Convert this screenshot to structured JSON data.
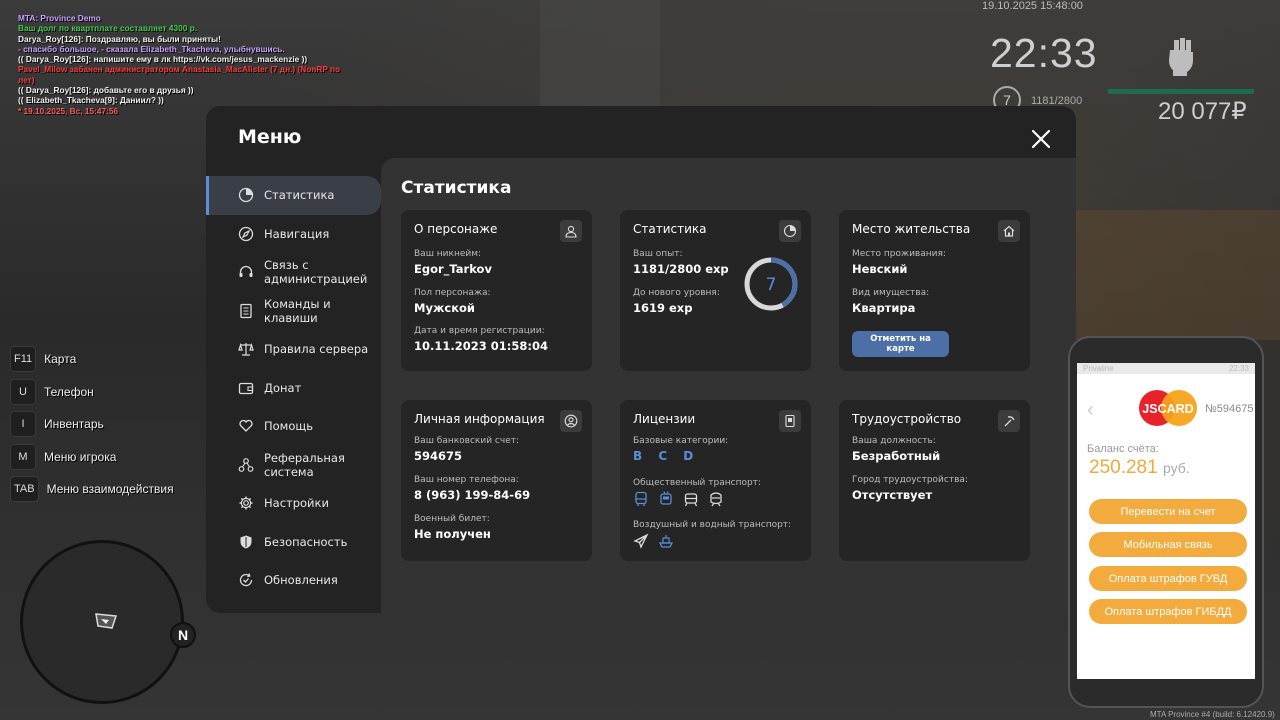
{
  "chat": [
    {
      "text": "MTA: Province Demo",
      "color": "#c9a0ff"
    },
    {
      "text": "Ваш долг по квартплате составляет 4300 р.",
      "color": "#41d24c"
    },
    {
      "text": "Darya_Roy[126]: Поздравляю, вы были приняты!",
      "color": "#f0f0f0"
    },
    {
      "text": "- спасибо большое, - сказала Elizabeth_Tkacheva, улыбнувшись.",
      "color": "#c9a0ff"
    },
    {
      "text": "(( Darya_Roy[126]: напишите ему в лк https://vk.com/jesus_mackenzie ))",
      "color": "#f0f0f0"
    },
    {
      "text": "Pavel_Milow забанен администратором Anastasia_MacAlister (7 дн.) (NonRP по",
      "color": "#ff3b3b"
    },
    {
      "text": "лет)",
      "color": "#ff3b3b"
    },
    {
      "text": "(( Darya_Roy[126]: добавьте его в друзья ))",
      "color": "#f0f0f0"
    },
    {
      "text": "(( Elizabeth_Tkacheva[9]: Даниил? ))",
      "color": "#f0f0f0"
    },
    {
      "text": "* 19.10.2025, Вс, 15:47:56",
      "color": "#ff5a5a"
    }
  ],
  "hud": {
    "date": "19.10.2025 15:48:00",
    "time": "22:33",
    "level": "7",
    "exp": "1181/2800",
    "money": "20 077₽"
  },
  "keys": [
    {
      "key": "F11",
      "label": "Карта"
    },
    {
      "key": "U",
      "label": "Телефон"
    },
    {
      "key": "I",
      "label": "Инвентарь"
    },
    {
      "key": "M",
      "label": "Меню игрока"
    },
    {
      "key": "TAB",
      "label": "Меню взаимодействия"
    }
  ],
  "minimap": {
    "north": "N"
  },
  "menu": {
    "title": "Меню",
    "nav": [
      {
        "label": "Статистика",
        "icon": "pie-chart-icon"
      },
      {
        "label": "Навигация",
        "icon": "compass-icon"
      },
      {
        "label": "Связь с\nадминистрацией",
        "icon": "headset-icon"
      },
      {
        "label": "Команды и\nклавиши",
        "icon": "document-icon"
      },
      {
        "label": "Правила сервера",
        "icon": "scales-icon"
      },
      {
        "label": "Донат",
        "icon": "wallet-icon"
      },
      {
        "label": "Помощь",
        "icon": "heart-hand-icon"
      },
      {
        "label": "Реферальная\nсистема",
        "icon": "network-icon"
      },
      {
        "label": "Настройки",
        "icon": "gear-icon"
      },
      {
        "label": "Безопасность",
        "icon": "shield-icon"
      },
      {
        "label": "Обновления",
        "icon": "refresh-check-icon"
      }
    ],
    "content_title": "Статистика",
    "cards": {
      "persona": {
        "title": "О персонаже",
        "nick_label": "Ваш никнейм:",
        "nick": "Egor_Tarkov",
        "gender_label": "Пол персонажа:",
        "gender": "Мужской",
        "reg_label": "Дата и время регистрации:",
        "reg": "10.11.2023 01:58:04"
      },
      "stats": {
        "title": "Статистика",
        "exp_label": "Ваш опыт:",
        "exp": "1181/2800 exp",
        "next_label": "До нового уровня:",
        "next": "1619 exp",
        "level": "7",
        "progress": 0.42
      },
      "residence": {
        "title": "Место жительства",
        "place_label": "Место проживания:",
        "place": "Невский",
        "property_label": "Вид имущества:",
        "property": "Квартира",
        "map_button": "Отметить на карте"
      },
      "personal": {
        "title": "Личная информация",
        "bank_label": "Ваш банковский счет:",
        "bank": "594675",
        "phone_label": "Ваш номер телефона:",
        "phone": "8 (963) 199-84-69",
        "military_label": "Военный билет:",
        "military": "Не получен"
      },
      "licenses": {
        "title": "Лицензии",
        "base_label": "Базовые категории:",
        "base": "B C D",
        "public_label": "Общественный транспорт:",
        "air_label": "Воздушный и водный транспорт:"
      },
      "job": {
        "title": "Трудоустройство",
        "position_label": "Ваша должность:",
        "position": "Безработный",
        "city_label": "Город трудоустройства:",
        "city": "Отсутствует"
      }
    }
  },
  "phone": {
    "operator": "Privaline",
    "clock": "22:33",
    "brand": "JSCARD",
    "card_number": "№594675",
    "balance_label": "Баланс счёта:",
    "balance": "250.281",
    "currency": "руб.",
    "buttons": [
      "Перевести на счет",
      "Мобильная связь",
      "Оплата штрафов ГУВД",
      "Оплата штрафов ГИБДД"
    ],
    "accent": "#f2ab3c"
  },
  "build": "MTA Province #4 (build: 6.12420.9)"
}
